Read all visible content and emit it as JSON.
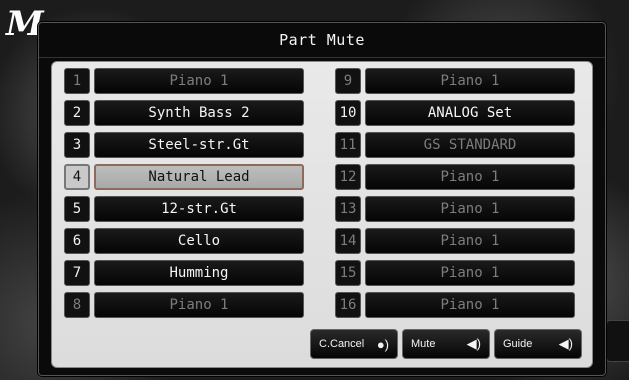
{
  "background": {
    "logo_text": "M"
  },
  "dialog": {
    "title": "Part Mute"
  },
  "parts_left": [
    {
      "num": "1",
      "name": "Piano 1",
      "dim": true
    },
    {
      "num": "2",
      "name": "Synth Bass 2",
      "dim": false
    },
    {
      "num": "3",
      "name": "Steel-str.Gt",
      "dim": false
    },
    {
      "num": "4",
      "name": "Natural Lead",
      "dim": false,
      "selected": true
    },
    {
      "num": "5",
      "name": "12-str.Gt",
      "dim": false
    },
    {
      "num": "6",
      "name": "Cello",
      "dim": false
    },
    {
      "num": "7",
      "name": "Humming",
      "dim": false
    },
    {
      "num": "8",
      "name": "Piano 1",
      "dim": true
    }
  ],
  "parts_right": [
    {
      "num": "9",
      "name": "Piano 1",
      "dim": true
    },
    {
      "num": "10",
      "name": "ANALOG Set",
      "dim": false
    },
    {
      "num": "11",
      "name": "GS STANDARD",
      "dim": true
    },
    {
      "num": "12",
      "name": "Piano 1",
      "dim": true
    },
    {
      "num": "13",
      "name": "Piano 1",
      "dim": true
    },
    {
      "num": "14",
      "name": "Piano 1",
      "dim": true
    },
    {
      "num": "15",
      "name": "Piano 1",
      "dim": true
    },
    {
      "num": "16",
      "name": "Piano 1",
      "dim": true
    }
  ],
  "buttons": {
    "cancel_label": "C.Cancel",
    "mute_label": "Mute",
    "guide_label": "Guide"
  },
  "icons": {
    "cancel": "person-speaker-icon",
    "mute": "speaker-muted-icon",
    "guide": "speaker-icon"
  }
}
